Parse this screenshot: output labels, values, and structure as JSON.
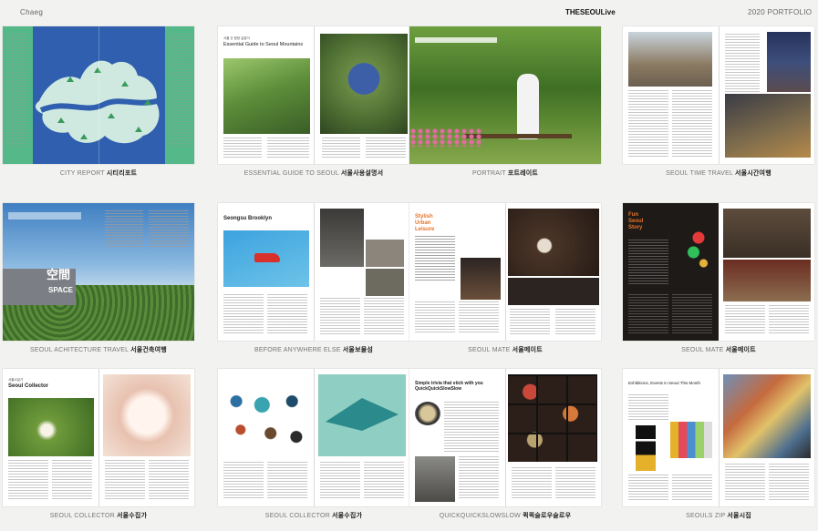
{
  "header": {
    "left": "Chaeg",
    "center": "THESEOULive",
    "right": "2020 PORTFOLIO"
  },
  "spreads": [
    {
      "caption_en": "CITY REPORT",
      "caption_ko": "시티리포트"
    },
    {
      "caption_en": "ESSENTIAL GUIDE TO SEOUL",
      "caption_ko": "서울사용설명서",
      "title": "Essential Guide to Seoul Mountains",
      "kicker": "서울 산 탐방 길잡이"
    },
    {
      "caption_en": "PORTRAIT",
      "caption_ko": "포트레이트"
    },
    {
      "caption_en": "SEOUL TIME TRAVEL",
      "caption_ko": "서울시간여행"
    },
    {
      "caption_en": "SEOUL ACHITECTURE TRAVEL",
      "caption_ko": "서울건축여행",
      "sign1": "空間",
      "sign2": "SPACE"
    },
    {
      "caption_en": "BEFORE ANYWHERE ELSE",
      "caption_ko": "서울보물섬",
      "title": "Seongsu Brooklyn"
    },
    {
      "caption_en": "SEOUL MATE",
      "caption_ko": "서울메이트",
      "title_lines": [
        "Stylish",
        "Urban",
        "Leisure"
      ]
    },
    {
      "caption_en": "SEOUL MATE",
      "caption_ko": "서울메이트",
      "title_lines": [
        "Fun",
        "Seoul",
        "Story"
      ]
    },
    {
      "caption_en": "SEOUL COLLECTOR",
      "caption_ko": "서울수집가",
      "kicker": "서울수집가",
      "title": "Seoul Collector"
    },
    {
      "caption_en": "SEOUL COLLECTOR",
      "caption_ko": "서울수집가"
    },
    {
      "caption_en": "QUICKQUICKSLOWSLOW",
      "caption_ko": "퀵퀵슬로우슬로우",
      "title": "Simple trivia that stick with you QuickQuickSlowSlow"
    },
    {
      "caption_en": "SEOULS ZIP",
      "caption_ko": "서울시집",
      "title": "Exhibitions, Events in Seoul This Month"
    }
  ],
  "colors": {
    "background": "#f2f2f0",
    "map_sea": "#2f5fae",
    "map_green": "#55b889",
    "accent_orange": "#e8742a"
  }
}
